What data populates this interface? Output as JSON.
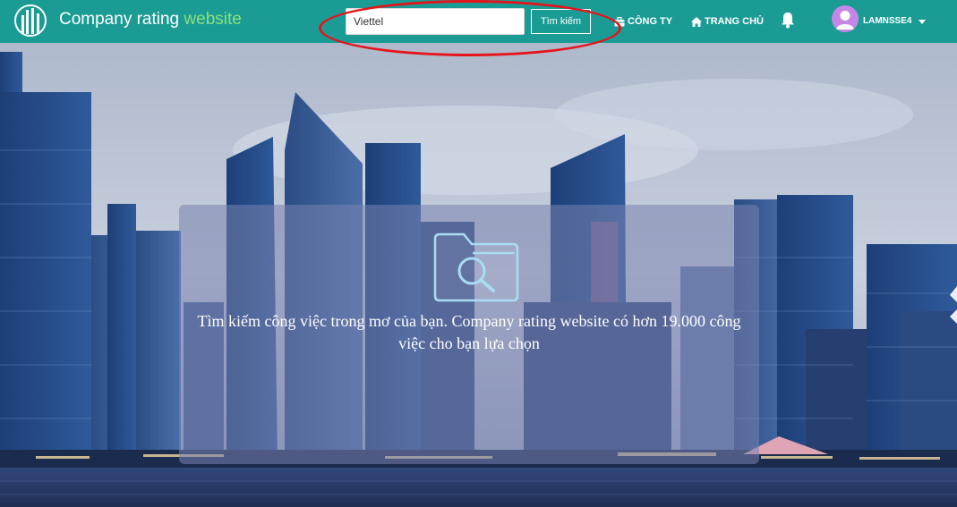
{
  "brand": {
    "name_main": "Company rating ",
    "name_accent": "website",
    "accent_color": "#8ee07c",
    "logo_icon": "city-building-logo-icon"
  },
  "navbar": {
    "background_color": "#1a9c95",
    "search": {
      "value": "Viettel",
      "button_label": "Tìm kiếm"
    },
    "links": [
      {
        "icon": "briefcase-icon",
        "label": "CÔNG TY"
      },
      {
        "icon": "home-icon",
        "label": "TRANG CHỦ"
      }
    ],
    "notification_icon": "bell-icon",
    "user": {
      "avatar_icon": "user-avatar-icon",
      "username": "LAMNSSE4",
      "dropdown_icon": "caret-down-icon"
    }
  },
  "annotation": {
    "shape": "red-ellipse",
    "color": "#e5141a"
  },
  "hero": {
    "background": "city-skyline-photo",
    "card_icon": "folder-search-icon",
    "headline": "Tìm kiếm công việc trong mơ của bạn. Company rating website có hơn 19.000 công việc cho bạn lựa chọn"
  }
}
